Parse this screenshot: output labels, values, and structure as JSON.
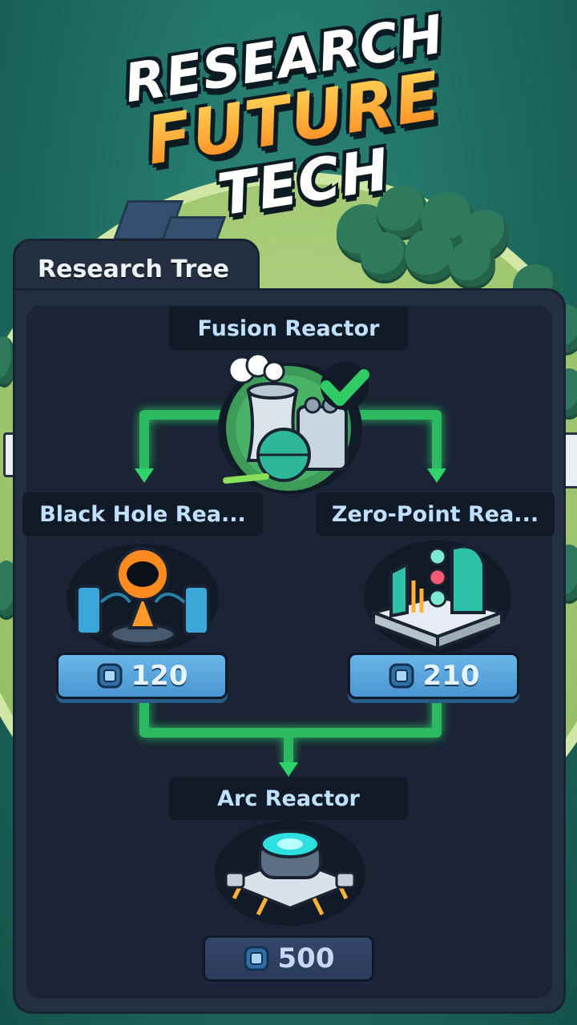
{
  "title": {
    "line1": "RESEARCH",
    "line2": "FUTURE",
    "line3": "TECH"
  },
  "panel": {
    "tab_label": "Research Tree"
  },
  "nodes": {
    "fusion": {
      "label": "Fusion Reactor",
      "status": "researched"
    },
    "black_hole": {
      "label": "Black Hole Rea...",
      "cost": "120",
      "status": "available"
    },
    "zero_point": {
      "label": "Zero-Point Rea...",
      "cost": "210",
      "status": "available"
    },
    "arc": {
      "label": "Arc Reactor",
      "cost": "500",
      "status": "locked"
    }
  },
  "icons": {
    "currency": "research-chip-icon",
    "check": "checkmark-icon"
  },
  "colors": {
    "link_glow": "#2fd46a",
    "button_active": "#5aa6df",
    "button_locked": "#2f4062",
    "accent_orange": "#ff9a2a"
  }
}
